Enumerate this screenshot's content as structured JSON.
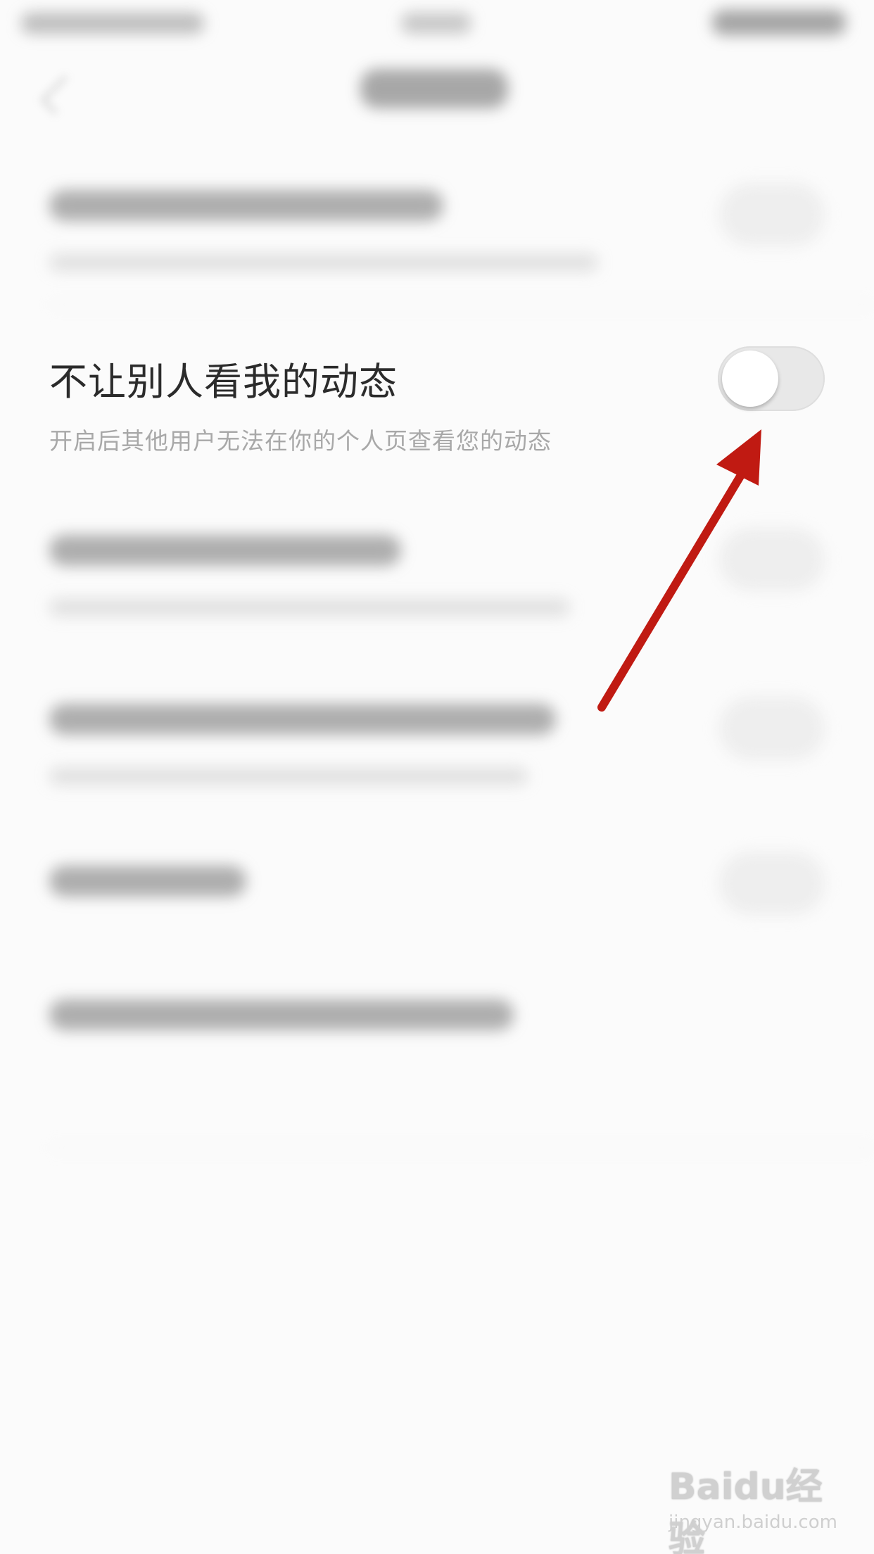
{
  "setting": {
    "title": "不让别人看我的动态",
    "description": "开启后其他用户无法在你的个人页查看您的动态",
    "enabled": false
  },
  "colors": {
    "background": "#fbfbfb",
    "title_text": "#2b2b2b",
    "description_text": "#a8a8a8",
    "toggle_off": "#e8e8e8",
    "arrow": "#c01a12"
  },
  "annotation": {
    "arrow_icon": "red-arrow-icon"
  },
  "watermark": {
    "logo_text": "Baidu经验",
    "url": "jingyan.baidu.com"
  }
}
